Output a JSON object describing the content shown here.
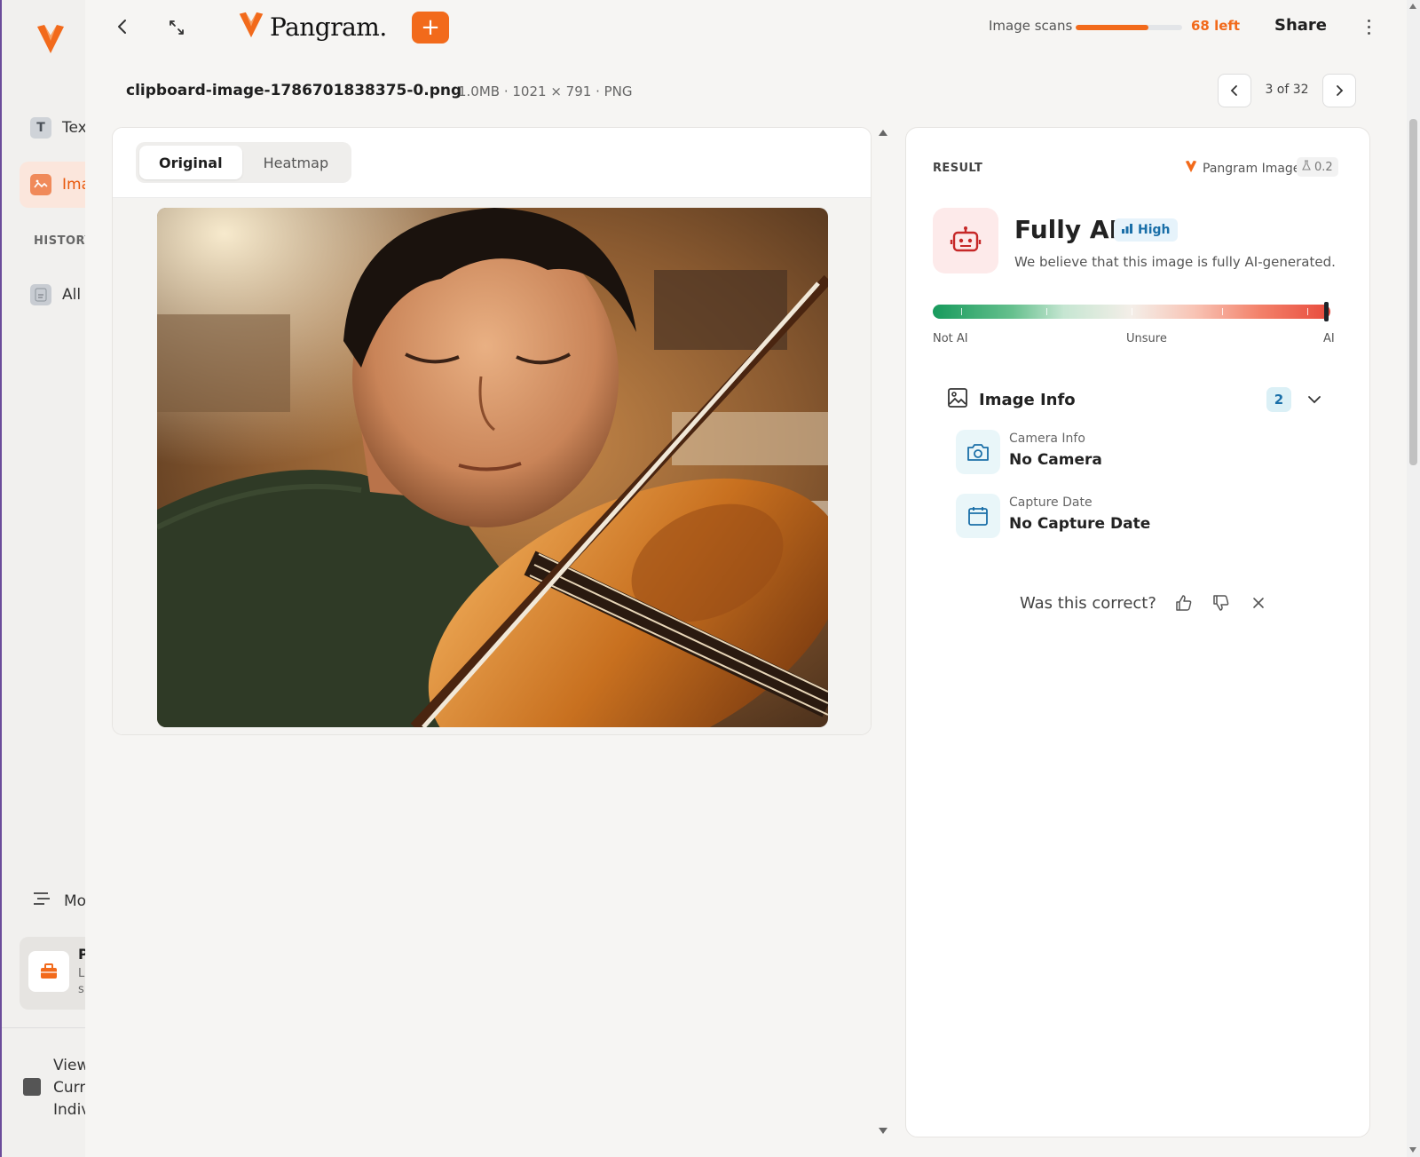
{
  "sidebar": {
    "items": [
      {
        "label": "Tex",
        "icon": "text-icon"
      },
      {
        "label": "Ima",
        "icon": "image-icon"
      }
    ],
    "history_label": "HISTORY",
    "history_items": [
      {
        "label": "All",
        "icon": "document-icon"
      }
    ],
    "more_label": "Mo",
    "card": {
      "title": "P",
      "line1": "Ll",
      "line2": "s"
    },
    "view": {
      "line1": "View",
      "line2": "Curre",
      "line3": "Indiv"
    }
  },
  "topbar": {
    "brand": "Pangram.",
    "scans_label": "Image scans",
    "scans_fraction": 0.68,
    "scans_left": "68 left",
    "share": "Share",
    "accent": "#f26a1b"
  },
  "file": {
    "name": "clipboard-image-1786701838375-0.png",
    "meta": "1.0MB · 1021 × 791 · PNG",
    "pager": "3 of 32"
  },
  "viewer": {
    "tabs": [
      {
        "label": "Original",
        "active": true
      },
      {
        "label": "Heatmap",
        "active": false
      }
    ]
  },
  "result": {
    "label": "RESULT",
    "model": "Pangram Image",
    "version": "0.2",
    "verdict": "Fully AI",
    "confidence": "High",
    "description": "We believe that this image is fully AI-generated.",
    "score_fraction": 0.99,
    "scale_labels": {
      "left": "Not AI",
      "middle": "Unsure",
      "right": "AI"
    },
    "info": {
      "title": "Image Info",
      "count": "2",
      "rows": [
        {
          "key": "Camera Info",
          "value": "No Camera",
          "icon": "camera-icon"
        },
        {
          "key": "Capture Date",
          "value": "No Capture Date",
          "icon": "calendar-icon"
        }
      ]
    },
    "feedback_question": "Was this correct?"
  }
}
